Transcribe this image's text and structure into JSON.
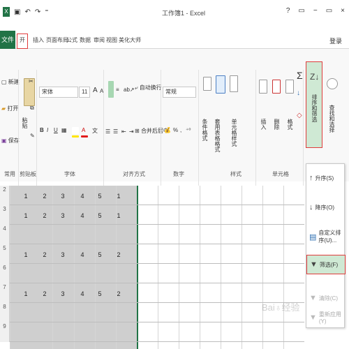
{
  "window": {
    "title": "工作簿1 - Excel",
    "controls": [
      "?",
      "▭",
      "−",
      "▭",
      "×"
    ]
  },
  "qat": {
    "undo": "↶",
    "redo": "↷",
    "more": "⁼"
  },
  "tabs": {
    "file": "文件",
    "items": [
      "开始",
      "插入",
      "页面布局",
      "公式",
      "数据",
      "审阅",
      "视图",
      "美化大师"
    ],
    "login": "登录"
  },
  "ribbon": {
    "new_label": "新建",
    "open_label": "打开",
    "save_label": "保存",
    "paste_label": "粘贴",
    "font_name": "宋体",
    "font_size": "11",
    "bold": "B",
    "italic": "I",
    "underline": "U",
    "wrap_text": "自动换行",
    "merge_center": "合并后居中",
    "number_format": "常规",
    "percent": "%",
    "thousands": ",",
    "conditional_format": "条件格式",
    "table_format": "套用表格格式",
    "cell_styles": "单元格样式",
    "insert": "插入",
    "delete": "删除",
    "format": "格式",
    "sort_filter": "排序和筛选",
    "find_select": "查找和选择",
    "grow_font": "A",
    "shrink_font": "A",
    "groups": [
      "常用",
      "剪贴板",
      "字体",
      "对齐方式",
      "数字",
      "样式",
      "单元格"
    ]
  },
  "sort_menu": {
    "items": [
      {
        "label": "升序(S)",
        "icon": "sort-ascending-icon"
      },
      {
        "label": "降序(O)",
        "icon": "sort-descending-icon"
      },
      {
        "label": "自定义排序(U)...",
        "icon": "custom-sort-icon"
      },
      {
        "label": "筛选(F)",
        "icon": "filter-icon"
      },
      {
        "label": "清除(C)",
        "icon": "clear-filter-icon"
      },
      {
        "label": "重新应用(Y)",
        "icon": "reapply-icon"
      }
    ],
    "active": "筛选(F)"
  },
  "sheet": {
    "rows": [
      {
        "header": "2",
        "values": [
          "1",
          "2",
          "3",
          "4",
          "5",
          "1"
        ]
      },
      {
        "header": "3",
        "values": [
          "1",
          "2",
          "3",
          "4",
          "5",
          "1"
        ]
      },
      {
        "header": "4",
        "values": []
      },
      {
        "header": "5",
        "values": [
          "1",
          "2",
          "3",
          "4",
          "5",
          "2"
        ]
      },
      {
        "header": "6",
        "values": []
      },
      {
        "header": "7",
        "values": [
          "1",
          "2",
          "3",
          "4",
          "5",
          "2"
        ]
      },
      {
        "header": "8",
        "values": []
      },
      {
        "header": "9",
        "values": []
      }
    ]
  },
  "colors": {
    "excel_green": "#217346",
    "highlight_red": "#e03c3c",
    "selection_gray": "#cfcfcf",
    "active_green": "#cfe9d4"
  }
}
